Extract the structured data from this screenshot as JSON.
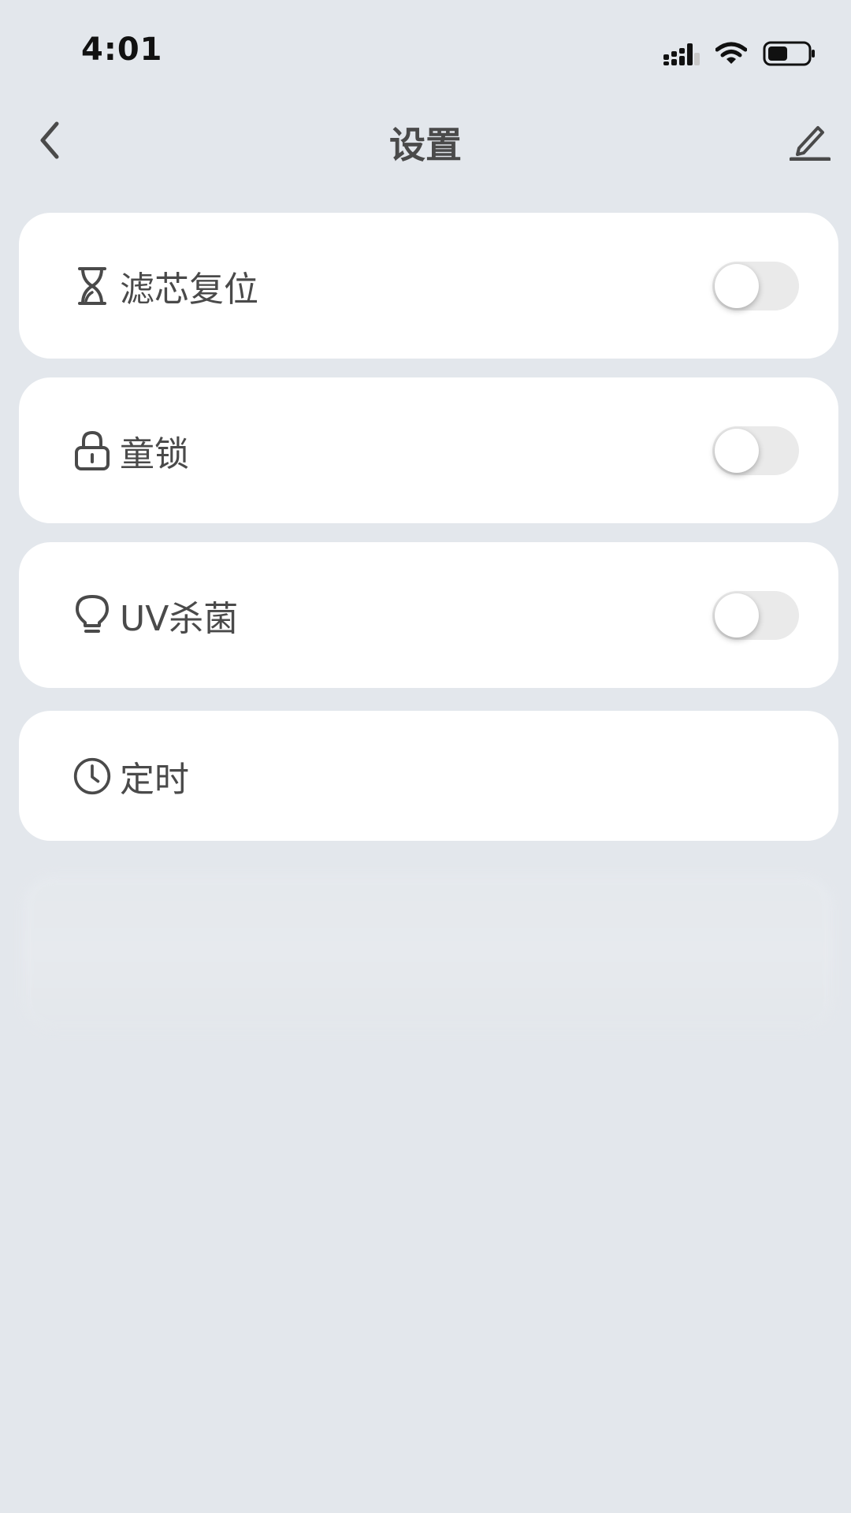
{
  "status_bar": {
    "time": "4:01",
    "icons": [
      "cellular-signal-icon",
      "wifi-icon",
      "battery-icon"
    ]
  },
  "nav": {
    "title": "设置",
    "back_icon": "chevron-left-icon",
    "edit_icon": "pencil-icon"
  },
  "settings": [
    {
      "label": "滤芯复位",
      "icon": "hourglass-icon",
      "toggle": false
    },
    {
      "label": "童锁",
      "icon": "lock-icon",
      "toggle": false
    },
    {
      "label": "UV杀菌",
      "icon": "lightbulb-icon",
      "toggle": false
    },
    {
      "label": "定时",
      "icon": "clock-icon"
    }
  ],
  "colors": {
    "background": "#e3e7ec",
    "card": "#ffffff",
    "text": "#4a4a4a",
    "toggle_off": "#eaeaea"
  }
}
